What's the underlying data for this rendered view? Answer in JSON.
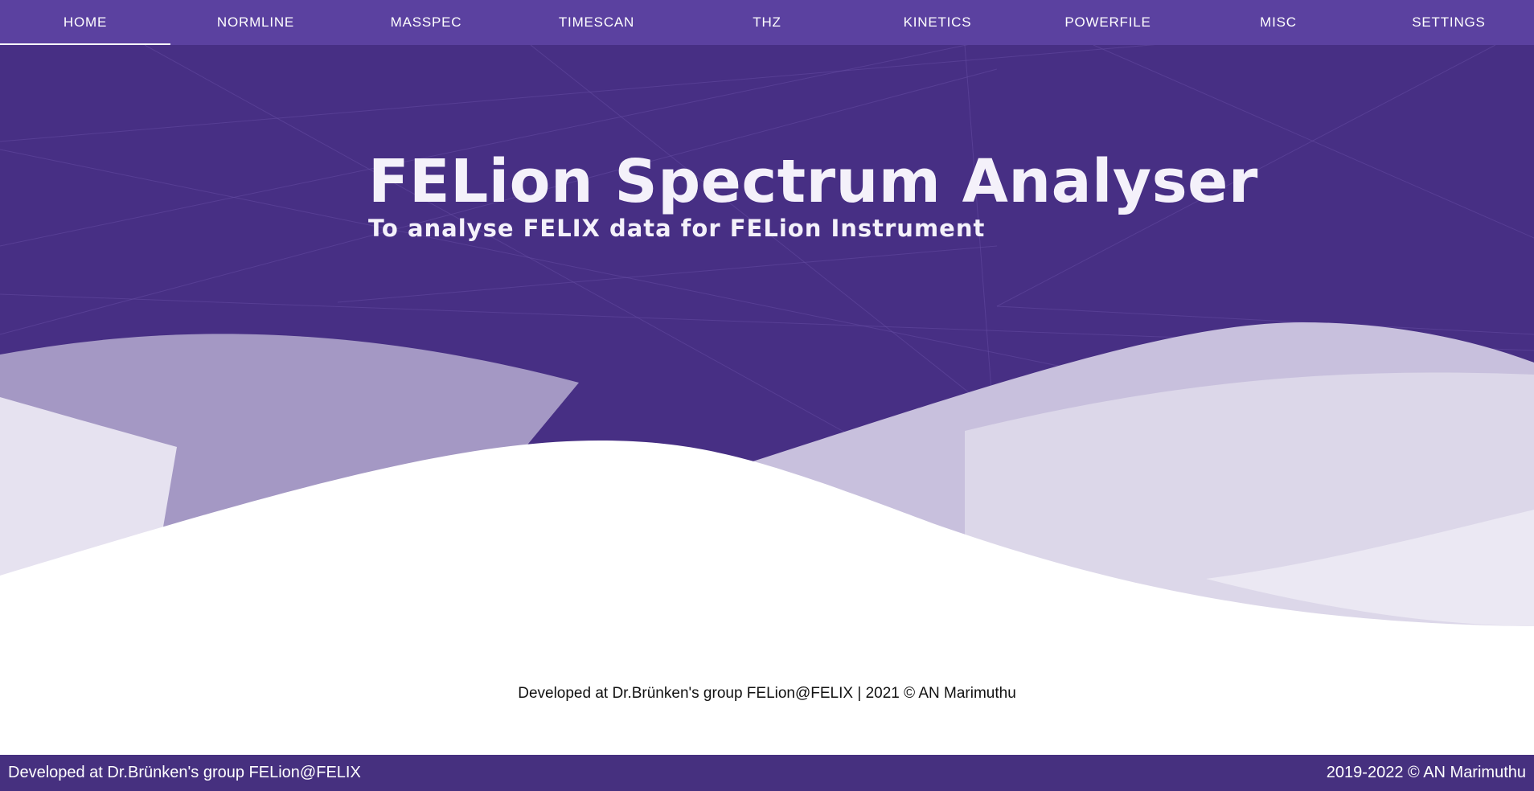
{
  "nav": {
    "tabs": [
      {
        "label": "HOME",
        "active": true
      },
      {
        "label": "NORMLINE",
        "active": false
      },
      {
        "label": "MASSPEC",
        "active": false
      },
      {
        "label": "TIMESCAN",
        "active": false
      },
      {
        "label": "THZ",
        "active": false
      },
      {
        "label": "KINETICS",
        "active": false
      },
      {
        "label": "POWERFILE",
        "active": false
      },
      {
        "label": "MISC",
        "active": false
      },
      {
        "label": "SETTINGS",
        "active": false
      }
    ]
  },
  "hero": {
    "title": "FELion Spectrum Analyser",
    "subtitle": "To analyse FELIX data for FELion Instrument"
  },
  "credit": {
    "text": "Developed at Dr.Brünken's group FELion@FELIX | 2021 © AN Marimuthu"
  },
  "footer": {
    "left": "Developed at Dr.Brünken's group FELion@FELIX",
    "right": "2019-2022 © AN Marimuthu"
  },
  "colors": {
    "nav_bg": "#5b41a0",
    "hero_bg": "#472f84",
    "footer_bg": "#46307f",
    "text_light": "#f4f1fa"
  }
}
